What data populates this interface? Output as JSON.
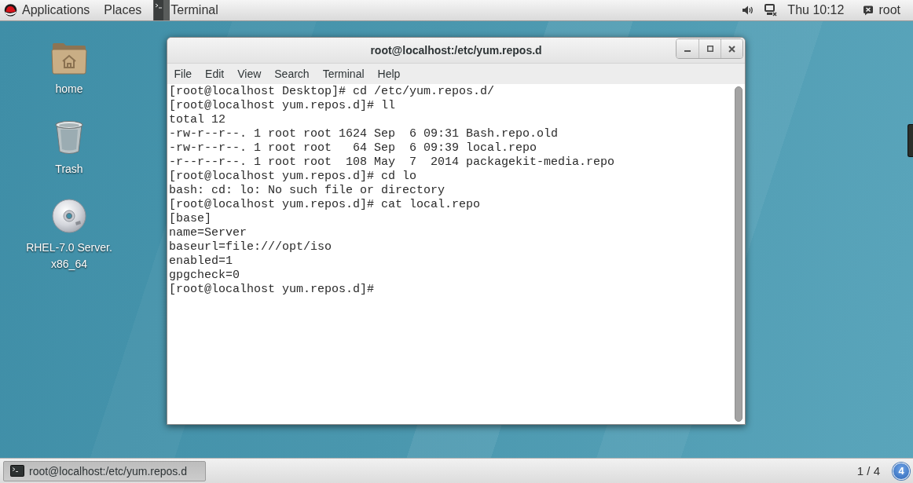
{
  "top_bar": {
    "applications": "Applications",
    "places": "Places",
    "app_menu": "Terminal",
    "clock": "Thu 10:12",
    "user": "root"
  },
  "desktop_icons": [
    {
      "kind": "folder",
      "label_lines": [
        "home"
      ]
    },
    {
      "kind": "trash",
      "label_lines": [
        "Trash"
      ]
    },
    {
      "kind": "disc",
      "label_lines": [
        "RHEL-7.0 Server.",
        "x86_64"
      ]
    }
  ],
  "terminal_window": {
    "title": "root@localhost:/etc/yum.repos.d",
    "menu": [
      "File",
      "Edit",
      "View",
      "Search",
      "Terminal",
      "Help"
    ],
    "lines": [
      "[root@localhost Desktop]# cd /etc/yum.repos.d/",
      "[root@localhost yum.repos.d]# ll",
      "total 12",
      "-rw-r--r--. 1 root root 1624 Sep  6 09:31 Bash.repo.old",
      "-rw-r--r--. 1 root root   64 Sep  6 09:39 local.repo",
      "-r--r--r--. 1 root root  108 May  7  2014 packagekit-media.repo",
      "[root@localhost yum.repos.d]# cd lo",
      "bash: cd: lo: No such file or directory",
      "[root@localhost yum.repos.d]# cat local.repo",
      "[base]",
      "name=Server",
      "baseurl=file:///opt/iso",
      "enabled=1",
      "gpgcheck=0",
      "[root@localhost yum.repos.d]#"
    ]
  },
  "taskbar": {
    "windows": [
      {
        "label": "root@localhost:/etc/yum.repos.d",
        "selected": true
      }
    ],
    "workspace": "1 / 4",
    "notification_count": "4"
  }
}
